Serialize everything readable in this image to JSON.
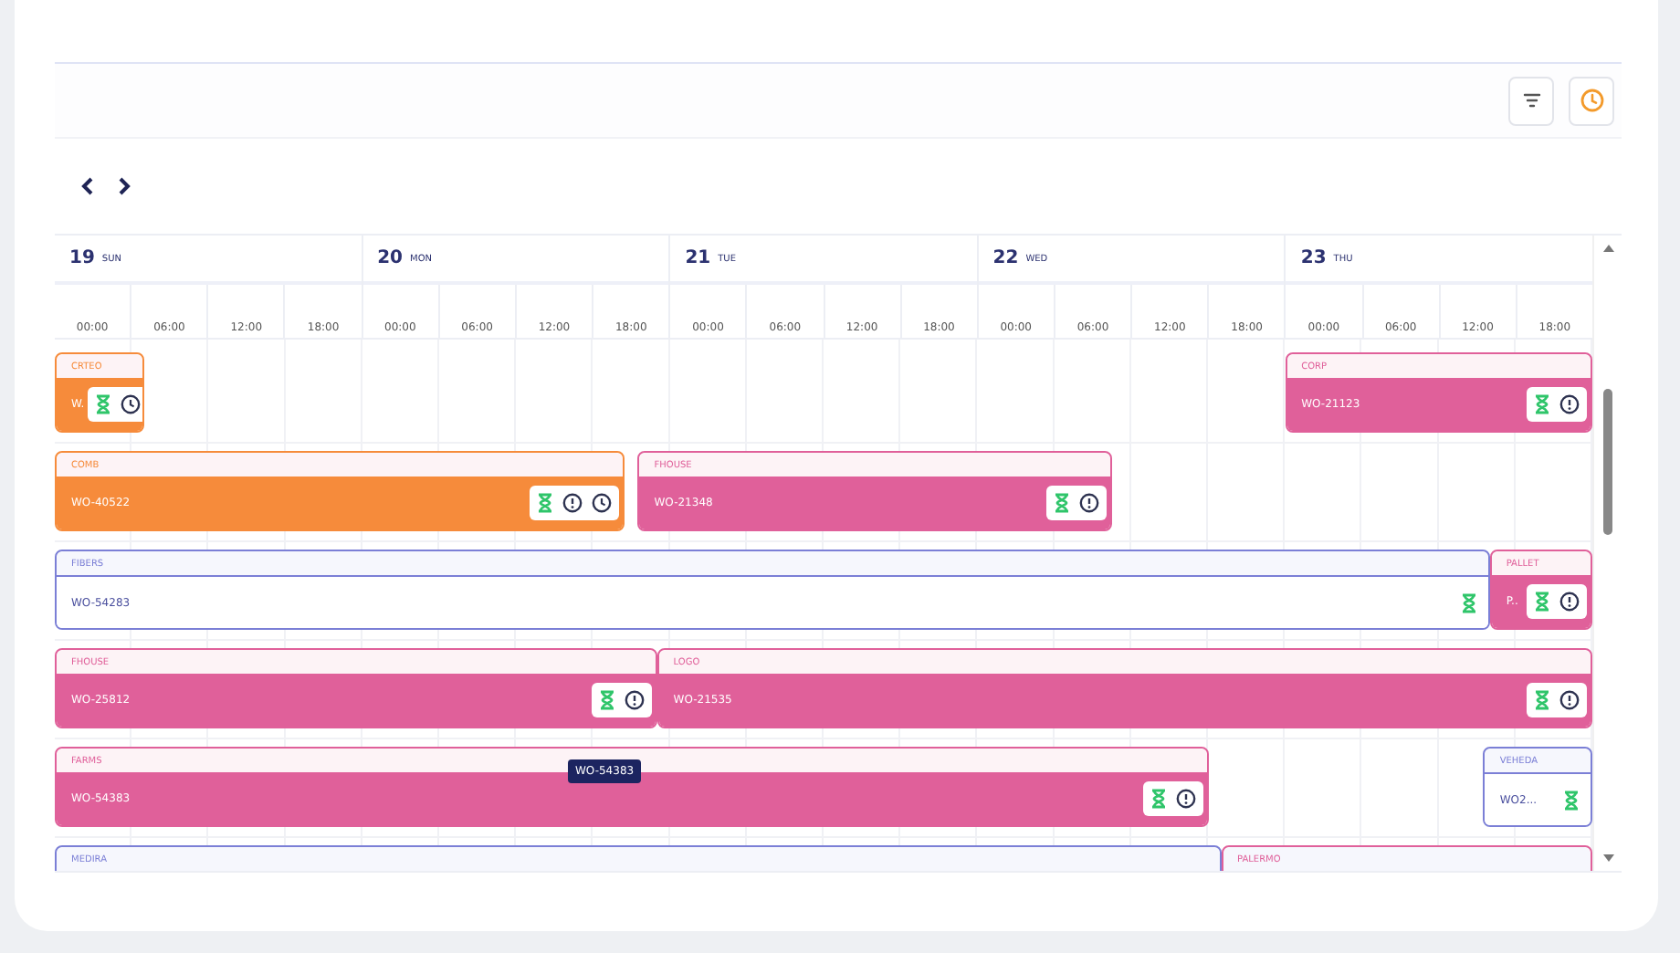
{
  "toolbar": {
    "buttons": [
      {
        "kind": "filter"
      },
      {
        "kind": "clock"
      }
    ]
  },
  "navigation": {
    "buttons": [
      {
        "kind": "prev"
      },
      {
        "kind": "next"
      }
    ]
  },
  "timeline": {
    "days": [
      {
        "number": "19",
        "weekday": "SUN",
        "hours": [
          "00:00",
          "06:00",
          "12:00",
          "18:00"
        ]
      },
      {
        "number": "20",
        "weekday": "MON",
        "hours": [
          "00:00",
          "06:00",
          "12:00",
          "18:00"
        ]
      },
      {
        "number": "21",
        "weekday": "TUE",
        "hours": [
          "00:00",
          "06:00",
          "12:00",
          "18:00"
        ]
      },
      {
        "number": "22",
        "weekday": "WED",
        "hours": [
          "00:00",
          "06:00",
          "12:00",
          "18:00"
        ]
      },
      {
        "number": "23",
        "weekday": "THU",
        "hours": [
          "00:00",
          "06:00",
          "12:00",
          "18:00"
        ]
      }
    ]
  },
  "lanes": [
    {
      "bars": [
        {
          "kind": "solid",
          "color": "#f68b3b",
          "category": "CRTEO",
          "label": "W.",
          "icons": [
            {
              "kind": "hourglass"
            },
            {
              "kind": "clock"
            }
          ]
        },
        {
          "kind": "solid",
          "color": "#e0609a",
          "category": "CORP",
          "label": "WO-21123",
          "icons": [
            {
              "kind": "hourglass"
            },
            {
              "kind": "info"
            }
          ]
        }
      ]
    },
    {
      "bars": [
        {
          "kind": "solid",
          "color": "#f68b3b",
          "category": "COMB",
          "label": "WO-40522",
          "icons": [
            {
              "kind": "hourglass"
            },
            {
              "kind": "info"
            },
            {
              "kind": "clock"
            }
          ]
        },
        {
          "kind": "solid",
          "color": "#e0609a",
          "category": "FHOUSE",
          "label": "WO-21348",
          "icons": [
            {
              "kind": "hourglass"
            },
            {
              "kind": "info"
            }
          ]
        }
      ]
    },
    {
      "bars": [
        {
          "kind": "outline",
          "color": "#7b7fd6",
          "category": "FIBERS",
          "label": "WO-54283",
          "icons": [
            {
              "kind": "hourglass"
            }
          ]
        },
        {
          "kind": "solid",
          "color": "#e0609a",
          "category": "PALLET",
          "label": "P..",
          "icons": [
            {
              "kind": "hourglass"
            },
            {
              "kind": "info"
            }
          ]
        }
      ]
    },
    {
      "bars": [
        {
          "kind": "solid",
          "color": "#e0609a",
          "category": "FHOUSE",
          "label": "WO-25812",
          "icons": [
            {
              "kind": "hourglass"
            },
            {
              "kind": "info"
            }
          ]
        },
        {
          "kind": "solid",
          "color": "#e0609a",
          "category": "LOGO",
          "label": "WO-21535",
          "icons": [
            {
              "kind": "hourglass"
            },
            {
              "kind": "info"
            }
          ]
        }
      ]
    },
    {
      "bars": [
        {
          "kind": "solid",
          "color": "#e0609a",
          "category": "FARMS",
          "label": "WO-54383",
          "tooltip": "WO-54383",
          "icons": [
            {
              "kind": "hourglass"
            },
            {
              "kind": "info"
            }
          ]
        },
        {
          "kind": "outline",
          "color": "#7b7fd6",
          "category": "VEHEDA",
          "label": "WO2...",
          "icons": [
            {
              "kind": "hourglass"
            }
          ]
        }
      ]
    },
    {
      "bars": [
        {
          "kind": "outline",
          "color": "#7b7fd6",
          "category": "MEDIRA"
        },
        {
          "kind": "outline",
          "color": "#e0609a",
          "category": "PALERMO"
        }
      ]
    }
  ]
}
